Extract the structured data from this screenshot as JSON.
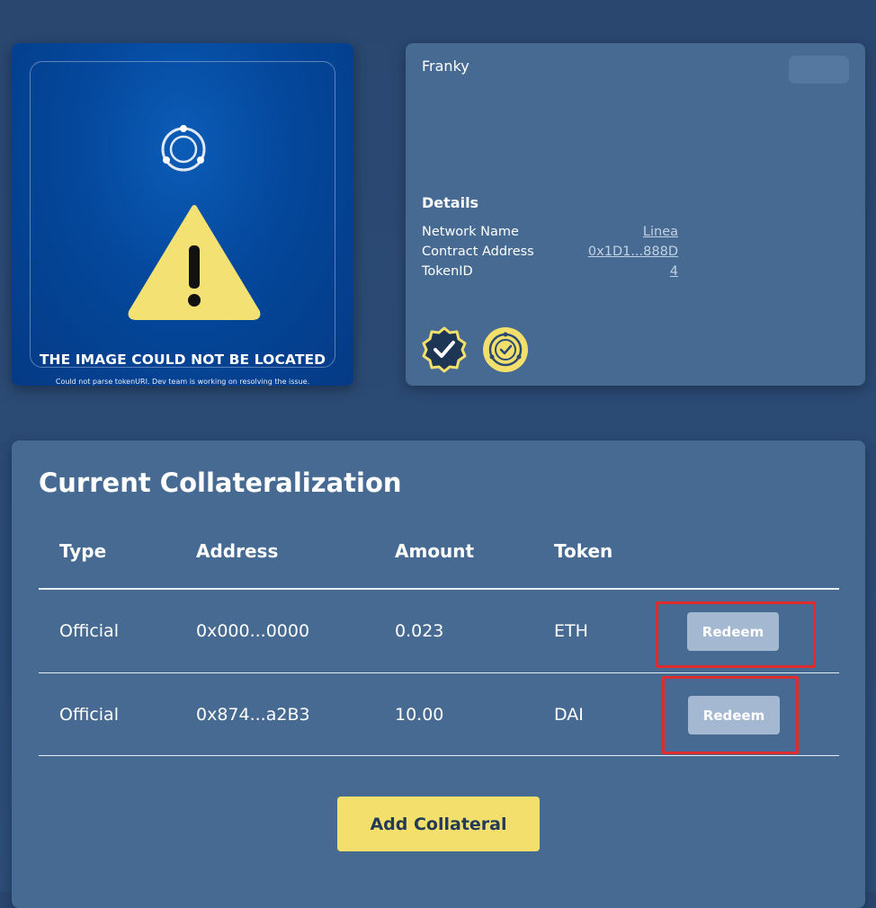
{
  "nft": {
    "error_title": "THE IMAGE COULD NOT BE LOCATED",
    "error_subtitle": "Could not parse tokenURI. Dev team is working on resolving the issue."
  },
  "details_card": {
    "name": "Franky",
    "heading": "Details",
    "rows": [
      {
        "label": "Network Name",
        "value": "Linea"
      },
      {
        "label": "Contract Address",
        "value": "0x1D1...888D"
      },
      {
        "label": "TokenID",
        "value": "4"
      }
    ],
    "badges": [
      "verified-badge-icon",
      "linea-badge-icon"
    ]
  },
  "collateral": {
    "title": "Current Collateralization",
    "columns": [
      "Type",
      "Address",
      "Amount",
      "Token"
    ],
    "rows": [
      {
        "type": "Official",
        "address": "0x000...0000",
        "amount": "0.023",
        "token": "ETH",
        "action": "Redeem"
      },
      {
        "type": "Official",
        "address": "0x874...a2B3",
        "amount": "10.00",
        "token": "DAI",
        "action": "Redeem"
      }
    ],
    "add_label": "Add Collateral"
  },
  "colors": {
    "background": "#2b4a74",
    "card": "#466a92",
    "accent_yellow": "#f3df6b",
    "redeem_button": "#a4b8d1",
    "highlight_red": "#e02b2b"
  }
}
